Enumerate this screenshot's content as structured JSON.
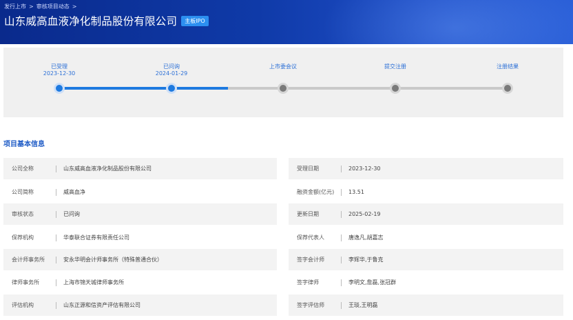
{
  "header": {
    "breadcrumb": [
      "发行上市",
      "审核项目动态"
    ],
    "title": "山东威高血液净化制品股份有限公司",
    "board_badge": "主板IPO"
  },
  "progress": {
    "steps": [
      {
        "label": "已受理",
        "date": "2023-12-30",
        "status": "done"
      },
      {
        "label": "已问询",
        "date": "2024-01-29",
        "status": "done"
      },
      {
        "label": "上市委会议",
        "date": "",
        "status": "todo"
      },
      {
        "label": "提交注册",
        "date": "",
        "status": "todo"
      },
      {
        "label": "注册结果",
        "date": "",
        "status": "todo"
      }
    ]
  },
  "section": {
    "title": "项目基本信息"
  },
  "info": {
    "left": [
      {
        "label": "公司全称",
        "value": "山东威高血液净化制品股份有限公司"
      },
      {
        "label": "公司简称",
        "value": "威高血净"
      },
      {
        "label": "审核状态",
        "value": "已问询"
      },
      {
        "label": "保荐机构",
        "value": "华泰联合证券有限责任公司"
      },
      {
        "label": "会计师事务所",
        "value": "安永华明会计师事务所（特殊普通合伙）"
      },
      {
        "label": "律师事务所",
        "value": "上海市锦天城律师事务所"
      },
      {
        "label": "评估机构",
        "value": "山东正源和信资产评估有限公司"
      }
    ],
    "right": [
      {
        "label": "受理日期",
        "value": "2023-12-30"
      },
      {
        "label": "融资金额(亿元)",
        "value": "13.51"
      },
      {
        "label": "更新日期",
        "value": "2025-02-19"
      },
      {
        "label": "保荐代表人",
        "value": "唐逸凡,胡嘉志"
      },
      {
        "label": "签字会计师",
        "value": "李辉华,于鲁克"
      },
      {
        "label": "签字律师",
        "value": "李明文,詹磊,张冠群"
      },
      {
        "label": "签字评估师",
        "value": "王琰,王明磊"
      }
    ]
  },
  "colors": {
    "accent": "#1e7ae0",
    "banner": "#0f3aa8",
    "badge": "#2c8ff0",
    "section_title": "#1e5bc6"
  }
}
